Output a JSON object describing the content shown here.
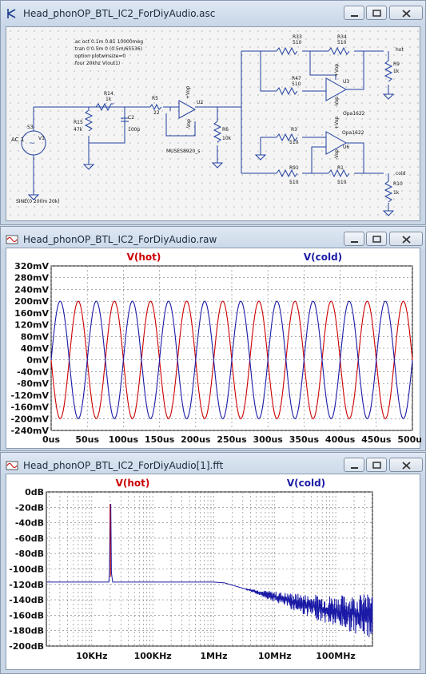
{
  "windows": {
    "asc": {
      "title": "Head_phonOP_BTL_IC2_ForDiyAudio.asc"
    },
    "raw": {
      "title": "Head_phonOP_BTL_IC2_ForDiyAudio.raw"
    },
    "fft": {
      "title": "Head_phonOP_BTL_IC2_ForDiyAudio[1].fft"
    }
  },
  "schematic": {
    "directives": [
      ".ac oct 0.1m 0.81 10000meg",
      ".tran 0 0.5m 0 (0.5m/65536)",
      ".option plotwinsize=0",
      ".four 20khz V(out1)"
    ],
    "components": {
      "R33": [
        "R33",
        "510"
      ],
      "R34": [
        "R34",
        "510"
      ],
      "R47": [
        "R47",
        "510"
      ],
      "R9": [
        "R9",
        "1k"
      ],
      "R14": [
        "R14",
        "1k"
      ],
      "R5": [
        "R5",
        "22"
      ],
      "R15": [
        "R15",
        "47k"
      ],
      "C2": [
        "C2",
        "100p"
      ],
      "R6": [
        "R6",
        "10k"
      ],
      "R3": [
        "R3",
        "510"
      ],
      "R91": [
        "R91",
        "510"
      ],
      "R1": [
        "R1",
        "510"
      ],
      "R10": [
        "R10",
        "1k"
      ]
    },
    "source": {
      "s3": "S3",
      "ac": "AC 1",
      "v1": "V1",
      "sine": "SINE(0 200m 20k)"
    },
    "opamps": {
      "u2": "U2",
      "u2part": "MUSES8920_s",
      "u3": "U3",
      "u3part": "Opa1622",
      "u6": "U6",
      "u6part": "Opa1622"
    },
    "supply": {
      "vop_pos": "+Vop",
      "vop_neg": "-Vop"
    },
    "nets": {
      "hot": "hot",
      "cold": "cold"
    }
  },
  "chart_data": [
    {
      "type": "line",
      "title": "",
      "legend": [
        "V(hot)",
        "V(cold)"
      ],
      "legend_colors": [
        "#cc0000",
        "#1a1aa6"
      ],
      "y_ticks": [
        "320mV",
        "280mV",
        "240mV",
        "200mV",
        "160mV",
        "120mV",
        "80mV",
        "40mV",
        "0mV",
        "-40mV",
        "-80mV",
        "-120mV",
        "-160mV",
        "-200mV",
        "-240mV"
      ],
      "x_ticks": [
        "0us",
        "50us",
        "100us",
        "150us",
        "200us",
        "250us",
        "300us",
        "350us",
        "400us",
        "450us",
        "500us"
      ],
      "ylim": [
        -240,
        320
      ],
      "xlim": [
        0,
        500
      ],
      "x_unit": "us",
      "y_unit": "mV",
      "series": [
        {
          "name": "V(hot)",
          "color": "#cc0000",
          "amplitude": 200,
          "frequency_khz": 20,
          "phase_deg": 180
        },
        {
          "name": "V(cold)",
          "color": "#1a1aa6",
          "amplitude": 200,
          "frequency_khz": 20,
          "phase_deg": 0
        }
      ],
      "grid": true
    },
    {
      "type": "line",
      "title": "",
      "legend": [
        "V(hot)",
        "V(cold)"
      ],
      "legend_colors": [
        "#cc0000",
        "#1a1aa6"
      ],
      "y_ticks": [
        "0dB",
        "-20dB",
        "-40dB",
        "-60dB",
        "-80dB",
        "-100dB",
        "-120dB",
        "-140dB",
        "-160dB",
        "-180dB",
        "-200dB"
      ],
      "x_ticks": [
        "10KHz",
        "100KHz",
        "1MHz",
        "10MHz",
        "100MHz"
      ],
      "ylim": [
        -200,
        0
      ],
      "xscale": "log",
      "xlim_hz": [
        1800,
        400000000
      ],
      "series": [
        {
          "name": "V(cold)",
          "color": "#1a1aa6",
          "points": [
            [
              1800,
              -117
            ],
            [
              19000,
              -117
            ],
            [
              19500,
              -105
            ],
            [
              20000,
              -16
            ],
            [
              20500,
              -16
            ],
            [
              21000,
              -105
            ],
            [
              22000,
              -117
            ],
            [
              1000000,
              -117
            ],
            [
              1500000,
              -118
            ],
            [
              3000000,
              -125
            ],
            [
              10000000,
              -136
            ],
            [
              30000000,
              -146
            ],
            [
              100000000,
              -155
            ],
            [
              200000000,
              -158
            ],
            [
              400000000,
              -161
            ]
          ]
        }
      ],
      "grid": true
    }
  ]
}
